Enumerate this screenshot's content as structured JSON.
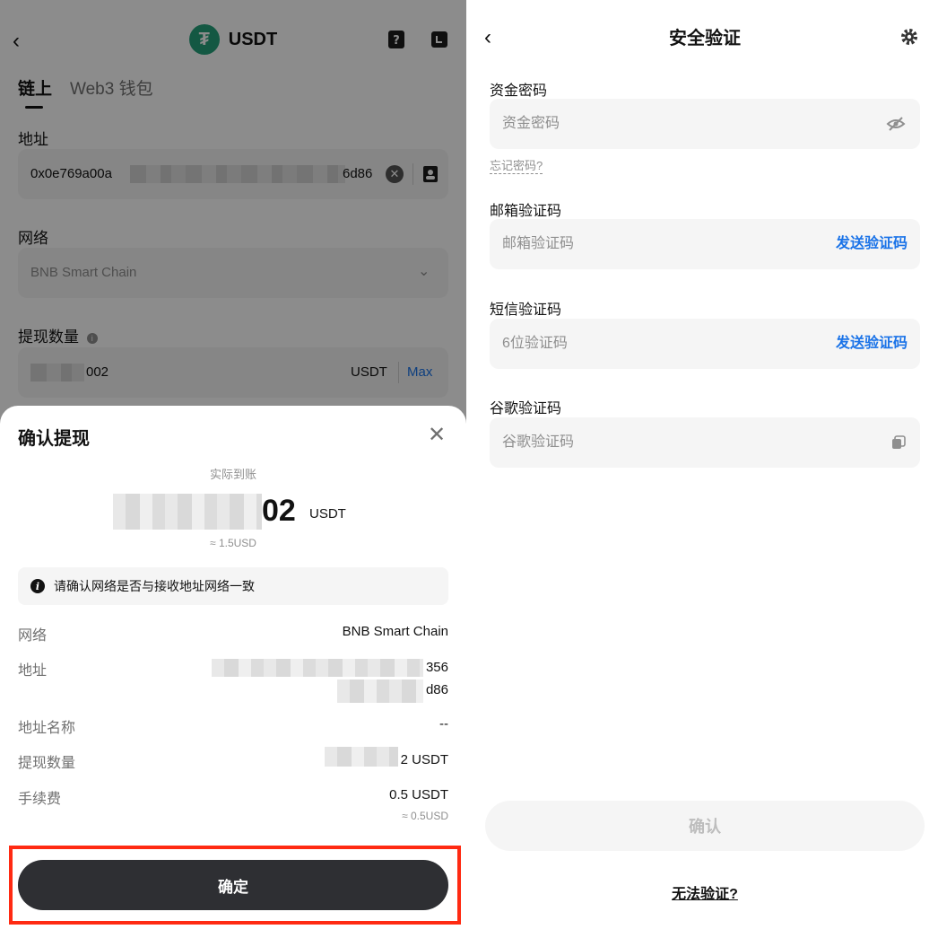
{
  "left": {
    "header": {
      "title": "USDT",
      "coin_glyph": "₮"
    },
    "tabs": [
      {
        "label": "链上"
      },
      {
        "label": "Web3 钱包"
      }
    ],
    "address": {
      "label": "地址",
      "value_start": "0x0e769a00a",
      "value_end": "6d86"
    },
    "network": {
      "label": "网络",
      "value": "BNB Smart Chain"
    },
    "amount": {
      "label": "提现数量",
      "value_end": "002",
      "unit": "USDT",
      "max": "Max"
    },
    "sheet": {
      "title": "确认提现",
      "received_label": "实际到账",
      "received_amount_end": "02",
      "received_unit": "USDT",
      "received_usd": "≈ 1.5USD",
      "notice": "请确认网络是否与接收地址网络一致",
      "rows": {
        "network": {
          "label": "网络",
          "value": "BNB Smart Chain"
        },
        "address": {
          "label": "地址",
          "line1_end": "356",
          "line2_end": "d86"
        },
        "address_name": {
          "label": "地址名称",
          "value": "--"
        },
        "amount": {
          "label": "提现数量",
          "value_end": "2 USDT"
        },
        "fee": {
          "label": "手续费",
          "value": "0.5 USDT",
          "usd": "≈ 0.5USD"
        }
      },
      "confirm_label": "确定"
    },
    "accent_highlight": "#ff2a12"
  },
  "right": {
    "title": "安全验证",
    "fund_password": {
      "label": "资金密码",
      "placeholder": "资金密码",
      "forgot": "忘记密码?"
    },
    "email_code": {
      "label": "邮箱验证码",
      "placeholder": "邮箱验证码",
      "send": "发送验证码"
    },
    "sms_code": {
      "label": "短信验证码",
      "placeholder": "6位验证码",
      "send": "发送验证码"
    },
    "google_code": {
      "label": "谷歌验证码",
      "placeholder": "谷歌验证码"
    },
    "confirm_label": "确认",
    "cannot_verify": "无法验证?"
  }
}
